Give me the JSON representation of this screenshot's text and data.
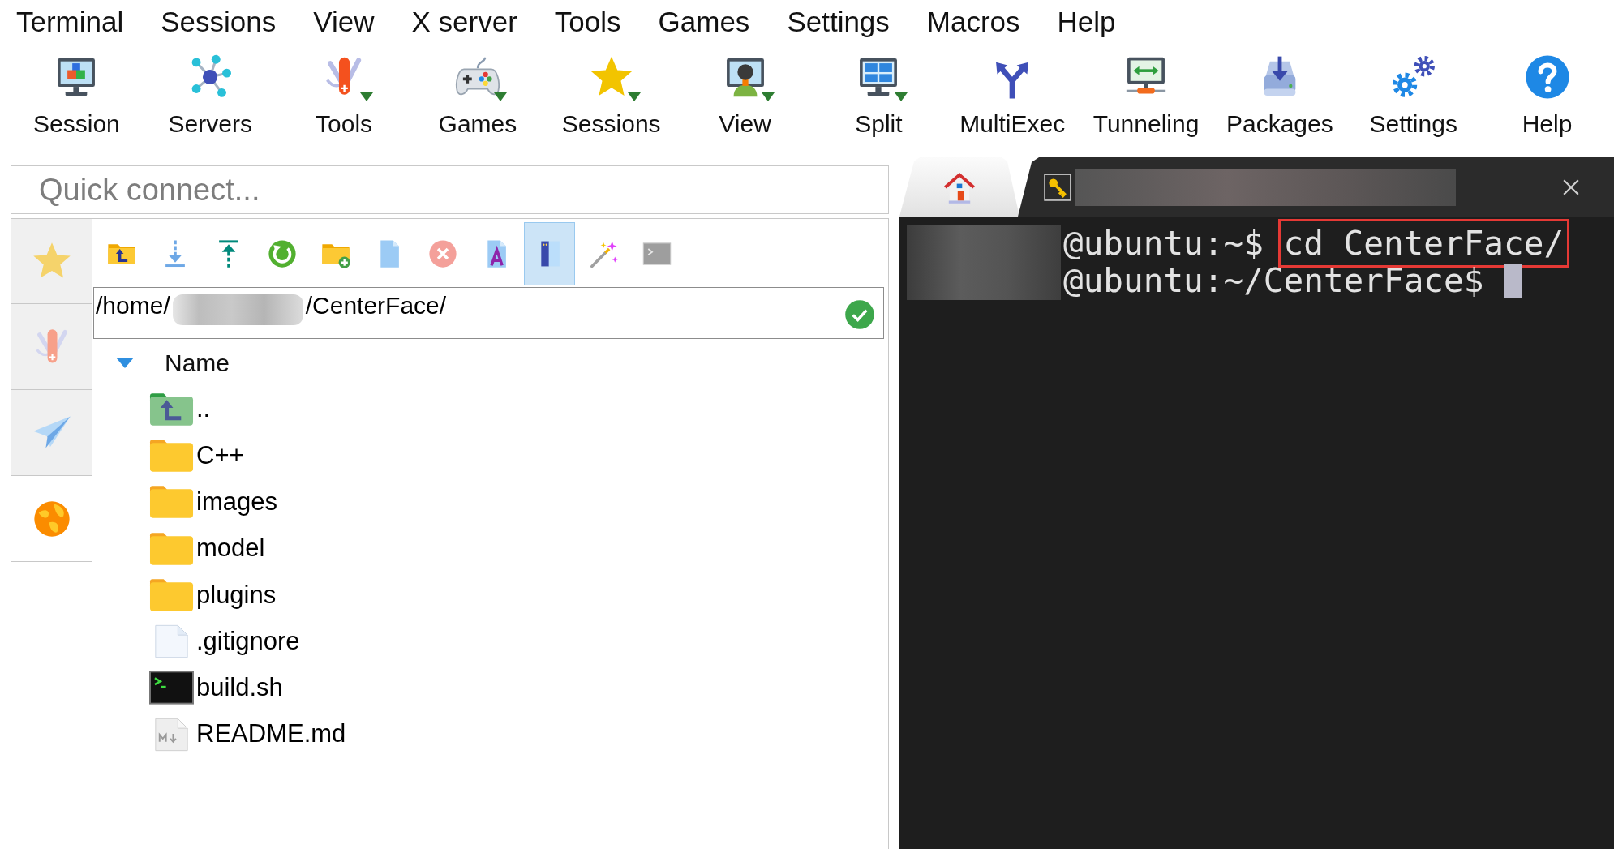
{
  "menu": [
    "Terminal",
    "Sessions",
    "View",
    "X server",
    "Tools",
    "Games",
    "Settings",
    "Macros",
    "Help"
  ],
  "toolbar": [
    {
      "label": "Session",
      "dropdown": false
    },
    {
      "label": "Servers",
      "dropdown": false
    },
    {
      "label": "Tools",
      "dropdown": true
    },
    {
      "label": "Games",
      "dropdown": true
    },
    {
      "label": "Sessions",
      "dropdown": true
    },
    {
      "label": "View",
      "dropdown": true
    },
    {
      "label": "Split",
      "dropdown": true
    },
    {
      "label": "MultiExec",
      "dropdown": false
    },
    {
      "label": "Tunneling",
      "dropdown": false
    },
    {
      "label": "Packages",
      "dropdown": false
    },
    {
      "label": "Settings",
      "dropdown": false
    },
    {
      "label": "Help",
      "dropdown": false
    }
  ],
  "quick_connect": {
    "placeholder": "Quick connect..."
  },
  "sidebar_tabs": [
    {
      "selected": false
    },
    {
      "selected": false
    },
    {
      "selected": false
    },
    {
      "selected": true
    }
  ],
  "file_toolbar": [
    {
      "on": false
    },
    {
      "on": false
    },
    {
      "on": false
    },
    {
      "on": false
    },
    {
      "on": false
    },
    {
      "on": false
    },
    {
      "on": false
    },
    {
      "on": false
    },
    {
      "on": true
    },
    {
      "on": false
    },
    {
      "on": false
    }
  ],
  "path_field": {
    "parts": [
      "/home/",
      "/CenterFace/"
    ],
    "valid": true
  },
  "file_list": {
    "column": "Name",
    "sorted": true,
    "rows": [
      {
        "name": "..",
        "kind": "parent"
      },
      {
        "name": "C++",
        "kind": "folder"
      },
      {
        "name": "images",
        "kind": "folder"
      },
      {
        "name": "model",
        "kind": "folder"
      },
      {
        "name": "plugins",
        "kind": "folder"
      },
      {
        "name": ".gitignore",
        "kind": "file"
      },
      {
        "name": "build.sh",
        "kind": "script"
      },
      {
        "name": "README.md",
        "kind": "markdown"
      }
    ]
  },
  "terminal_tabs": [
    {
      "kind": "home",
      "selected": false
    },
    {
      "kind": "session",
      "selected": true
    }
  ],
  "terminal": {
    "lines": [
      {
        "prompt": "@ubuntu:~$",
        "command": "cd CenterFace/",
        "highlighted": true,
        "cursor": false
      },
      {
        "prompt": "@ubuntu:~/CenterFace$",
        "highlighted": false,
        "cursor": true
      }
    ]
  }
}
